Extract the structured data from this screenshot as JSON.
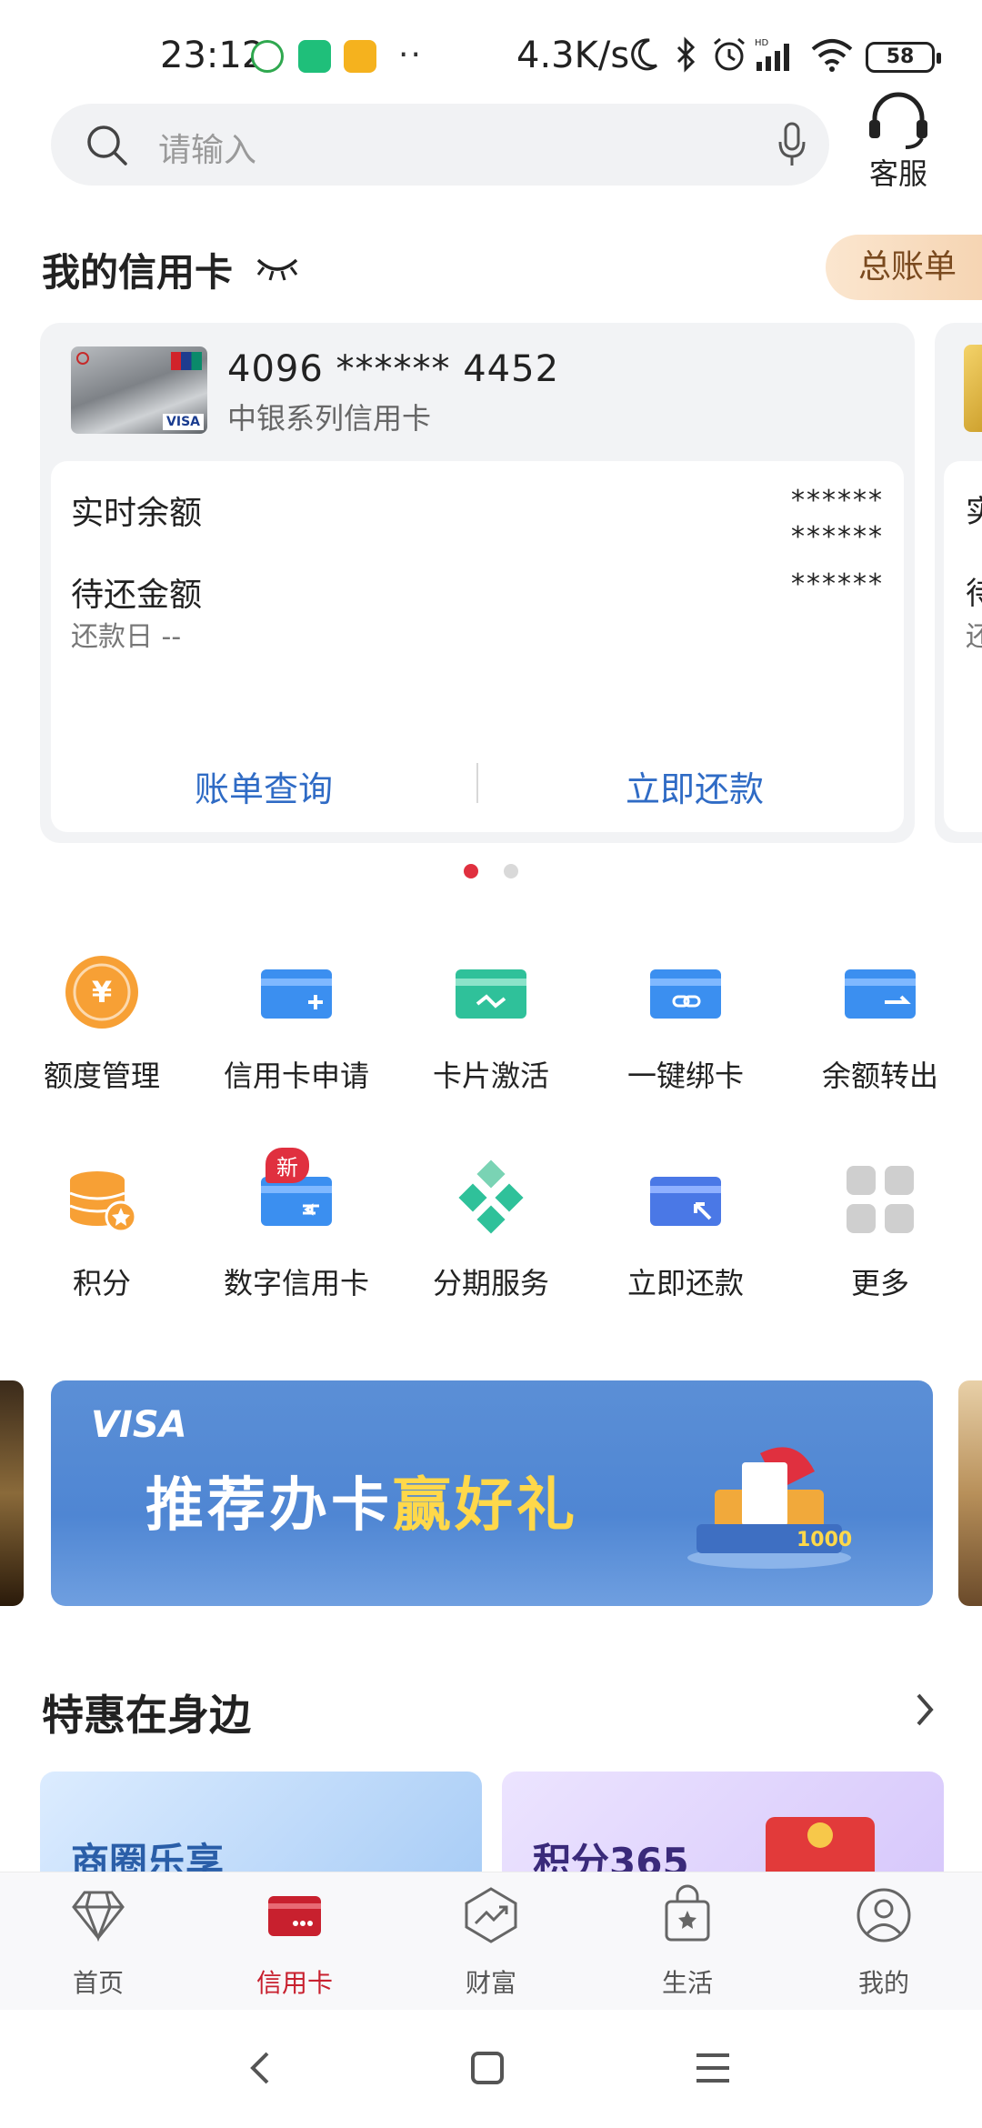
{
  "status_bar": {
    "time": "23:12",
    "dots": "··",
    "net_speed": "4.3K/s",
    "battery": "58",
    "icons": [
      "app-green-badge-icon",
      "app-green-icon",
      "app-yellow-icon",
      "moon-icon",
      "bluetooth-icon",
      "alarm-icon",
      "signal-hd-icon",
      "wifi-icon",
      "battery-icon"
    ]
  },
  "search": {
    "placeholder": "请输入"
  },
  "service": {
    "label": "客服"
  },
  "my_cards": {
    "title": "我的信用卡",
    "total_bill": "总账单",
    "card": {
      "number": "4096 ****** 4452",
      "type": "中银系列信用卡",
      "realtime_balance_label": "实时余额",
      "realtime_balance_value": "******",
      "realtime_balance_value2": "******",
      "due_amount_label": "待还金额",
      "due_amount_value": "******",
      "due_date_label": "还款日 --",
      "bill_query": "账单查询",
      "repay_now": "立即还款"
    },
    "next_card_peek": {
      "label1": "实",
      "label2": "待",
      "label3": "还"
    }
  },
  "grid": {
    "row1": [
      {
        "label": "额度管理"
      },
      {
        "label": "信用卡申请"
      },
      {
        "label": "卡片激活"
      },
      {
        "label": "一键绑卡"
      },
      {
        "label": "余额转出"
      }
    ],
    "row2": [
      {
        "label": "积分"
      },
      {
        "label": "数字信用卡",
        "badge": "新"
      },
      {
        "label": "分期服务"
      },
      {
        "label": "立即还款"
      },
      {
        "label": "更多"
      }
    ]
  },
  "banner": {
    "brand": "VISA",
    "promo_white": "推荐办卡",
    "promo_gold": "赢好礼",
    "amount": "1000"
  },
  "deals": {
    "title": "特惠在身边",
    "cards": [
      {
        "title": "商圈乐享",
        "color": "#2a5ea8"
      },
      {
        "title": "积分365",
        "color": "#3a2a7a"
      }
    ]
  },
  "bottom_nav": [
    {
      "label": "首页",
      "active": false
    },
    {
      "label": "信用卡",
      "active": true
    },
    {
      "label": "财富",
      "active": false
    },
    {
      "label": "生活",
      "active": false
    },
    {
      "label": "我的",
      "active": false
    }
  ],
  "colors": {
    "accent_red": "#c8202e",
    "link_blue": "#2f6bc5",
    "icon_blue": "#3b8ff0",
    "icon_green": "#2fc19a",
    "icon_orange": "#f7a035"
  }
}
